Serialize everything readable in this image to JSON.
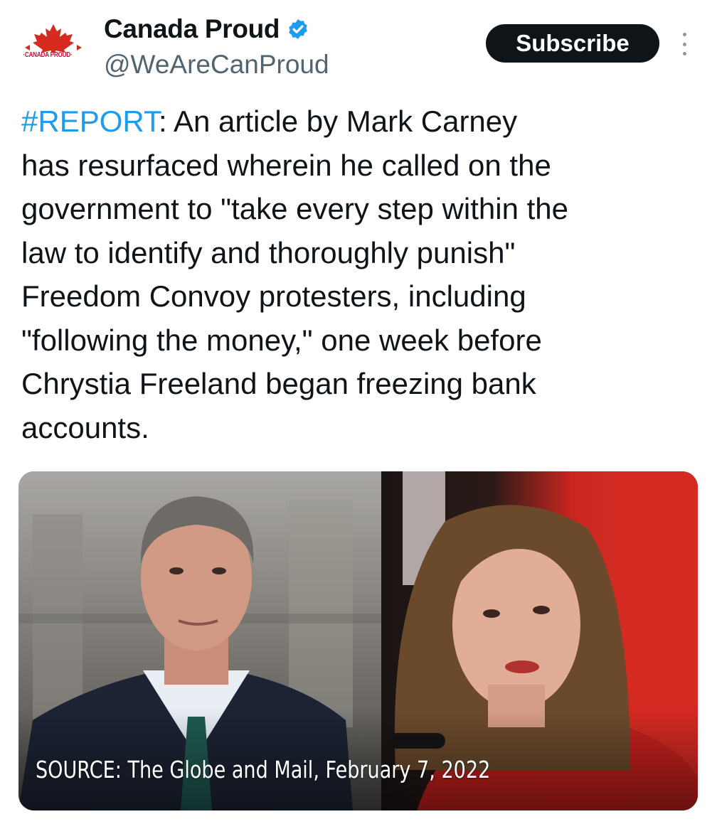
{
  "account": {
    "avatar_text": "·CANADA PROUD·",
    "display_name": "Canada Proud",
    "handle": "@WeAreCanProud",
    "verified": true,
    "verified_color": "#1d9bf0"
  },
  "actions": {
    "subscribe_label": "Subscribe",
    "more_icon": "more-vertical-icon"
  },
  "tweet": {
    "hashtag": "#REPORT",
    "line1_rest": ": An article by Mark Carney",
    "lines": [
      "has resurfaced wherein he called on the",
      "government to \"take every step within the",
      "law to identify and thoroughly punish\"",
      "Freedom Convoy protesters, including",
      "\"following the money,\" one week before",
      "Chrystia Freeland began freezing bank",
      "accounts."
    ]
  },
  "media": {
    "caption": "SOURCE: The Globe and Mail, February 7, 2022"
  },
  "colors": {
    "link": "#1d9bf0",
    "text": "#0f1419",
    "secondary": "#536471",
    "button_bg": "#0f1419",
    "brand_red": "#c8102e"
  }
}
